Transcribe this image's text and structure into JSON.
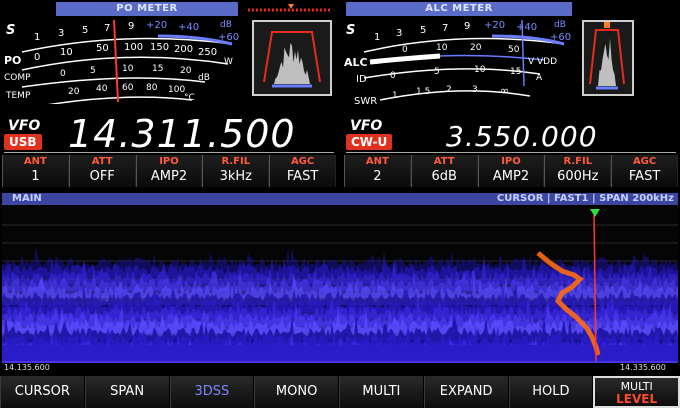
{
  "po_meter": {
    "title": "PO METER",
    "s_label": "S",
    "s_scale": [
      "1",
      "3",
      "5",
      "7",
      "9",
      "+20",
      "+40",
      "+60"
    ],
    "s_unit": "dB",
    "po_label": "PO",
    "po_scale": [
      "0",
      "10",
      "50",
      "100",
      "150",
      "200",
      "250"
    ],
    "po_unit": "W",
    "comp_label": "COMP",
    "comp_scale": [
      "0",
      "5",
      "10",
      "15",
      "20"
    ],
    "comp_unit": "dB",
    "temp_label": "TEMP",
    "temp_scale": [
      "20",
      "40",
      "60",
      "80",
      "100"
    ],
    "temp_unit": "°C"
  },
  "alc_meter": {
    "title": "ALC METER",
    "s_label": "S",
    "s_scale": [
      "1",
      "3",
      "5",
      "7",
      "9",
      "+20",
      "+40",
      "+60"
    ],
    "s_unit": "dB",
    "alc_label": "ALC",
    "vdd_scale": [
      "0",
      "10",
      "20",
      "50"
    ],
    "vdd_unit": "V VDD",
    "id_label": "ID",
    "id_scale": [
      "0",
      "5",
      "10",
      "15"
    ],
    "id_unit": "A",
    "swr_label": "SWR",
    "swr_scale": [
      "1",
      "1.5",
      "2",
      "3",
      "∞"
    ]
  },
  "main_vfo": {
    "tag": "VFO",
    "mode": "USB",
    "frequency": "14.311.500",
    "settings": [
      {
        "label": "ANT",
        "value": "1"
      },
      {
        "label": "ATT",
        "value": "OFF"
      },
      {
        "label": "IPO",
        "value": "AMP2"
      },
      {
        "label": "R.FIL",
        "value": "3kHz"
      },
      {
        "label": "AGC",
        "value": "FAST"
      }
    ]
  },
  "sub_vfo": {
    "tag": "VFO",
    "mode": "CW-U",
    "frequency": "3.550.000",
    "settings": [
      {
        "label": "ANT",
        "value": "2"
      },
      {
        "label": "ATT",
        "value": "6dB"
      },
      {
        "label": "IPO",
        "value": "AMP2"
      },
      {
        "label": "R.FIL",
        "value": "600Hz"
      },
      {
        "label": "AGC",
        "value": "FAST"
      }
    ]
  },
  "scope": {
    "title": "MAIN",
    "status": "CURSOR | FAST1 | SPAN   200kHz",
    "left_freq": "14.135.600",
    "right_freq": "14.335.600"
  },
  "soft_keys": [
    {
      "label": "CURSOR",
      "active": false
    },
    {
      "label": "SPAN",
      "active": false
    },
    {
      "label": "3DSS",
      "active": true
    },
    {
      "label": "MONO",
      "active": false
    },
    {
      "label": "MULTI",
      "active": false
    },
    {
      "label": "EXPAND",
      "active": false
    },
    {
      "label": "HOLD",
      "active": false
    }
  ],
  "multi_key": {
    "line1": "MULTI",
    "line2": "LEVEL"
  },
  "colors": {
    "accent_red": "#e0301e",
    "meter_blue": "#5a6cc8",
    "spectrum_blue": "#3a28e0",
    "cursor_orange": "#ff6a10"
  }
}
